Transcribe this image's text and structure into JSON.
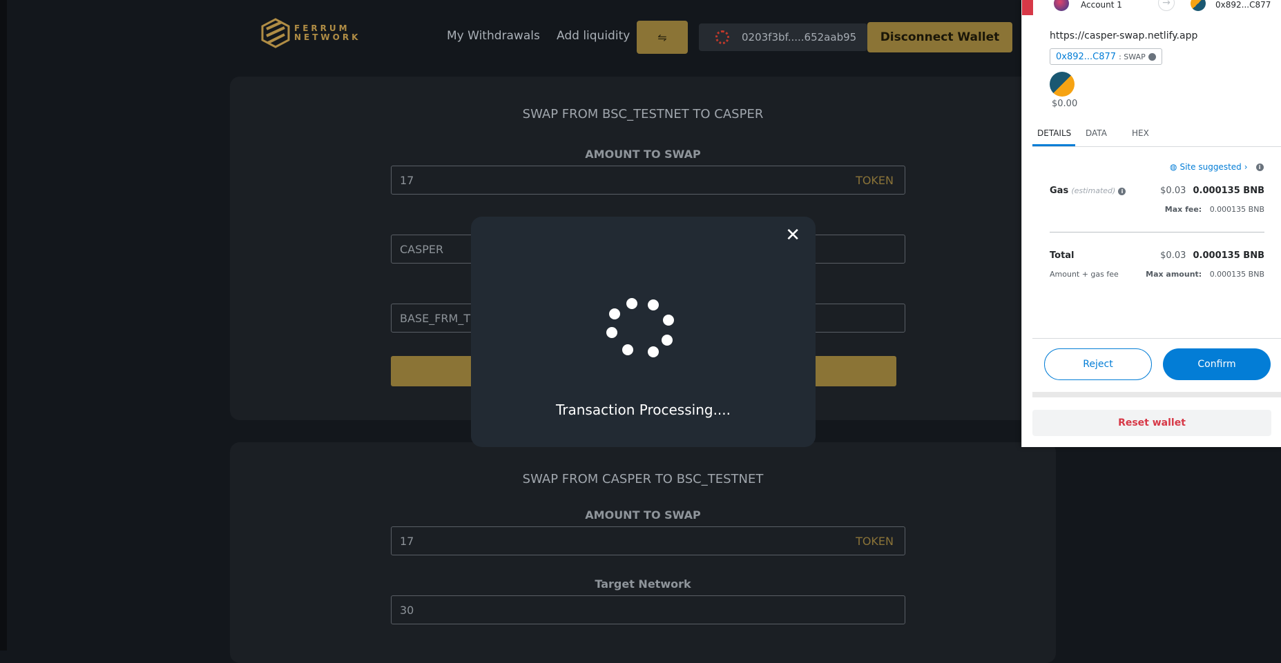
{
  "header": {
    "logo_text_line1": "FERRUM",
    "logo_text_line2": "NETWORK",
    "nav_withdrawals": "My Withdrawals",
    "nav_add_liquidity": "Add liquidity",
    "toggle_icon": "swap-arrows-icon",
    "wallet_address": "0203f3bf.....652aab95",
    "disconnect_label": "Disconnect Wallet"
  },
  "swap_to_casper": {
    "title": "SWAP FROM BSC_TESTNET TO CASPER",
    "amount_label": "AMOUNT TO SWAP",
    "amount_value": "17",
    "amount_suffix": "TOKEN",
    "network_value": "CASPER",
    "token_value": "BASE_FRM_T"
  },
  "swap_from_casper": {
    "title": "SWAP FROM CASPER TO BSC_TESTNET",
    "amount_label": "AMOUNT TO SWAP",
    "amount_value": "17",
    "amount_suffix": "TOKEN",
    "network_label": "Target Network",
    "network_value": "30"
  },
  "modal": {
    "close_icon": "close-icon",
    "message": "Transaction Processing...."
  },
  "metamask": {
    "account_name": "Account 1",
    "to_address": "0x892...C877",
    "site_url": "https://casper-swap.netlify.app",
    "contract_address": "0x892...C877",
    "method": ": SWAP",
    "token_amount": "$0.00",
    "tabs": [
      "DETAILS",
      "DATA",
      "HEX"
    ],
    "site_suggested": "Site suggested",
    "gas_label": "Gas",
    "gas_estimated": "(estimated)",
    "gas_fiat": "$0.03",
    "gas_value": "0.000135 BNB",
    "max_fee_label": "Max fee:",
    "max_fee_value": "0.000135 BNB",
    "total_label": "Total",
    "total_fiat": "$0.03",
    "total_value": "0.000135 BNB",
    "total_sub": "Amount + gas fee",
    "max_amount_label": "Max amount:",
    "max_amount_value": "0.000135 BNB",
    "reject_label": "Reject",
    "confirm_label": "Confirm",
    "reset_label": "Reset wallet",
    "colors": {
      "primary": "#037dd6",
      "danger": "#d73847"
    }
  }
}
